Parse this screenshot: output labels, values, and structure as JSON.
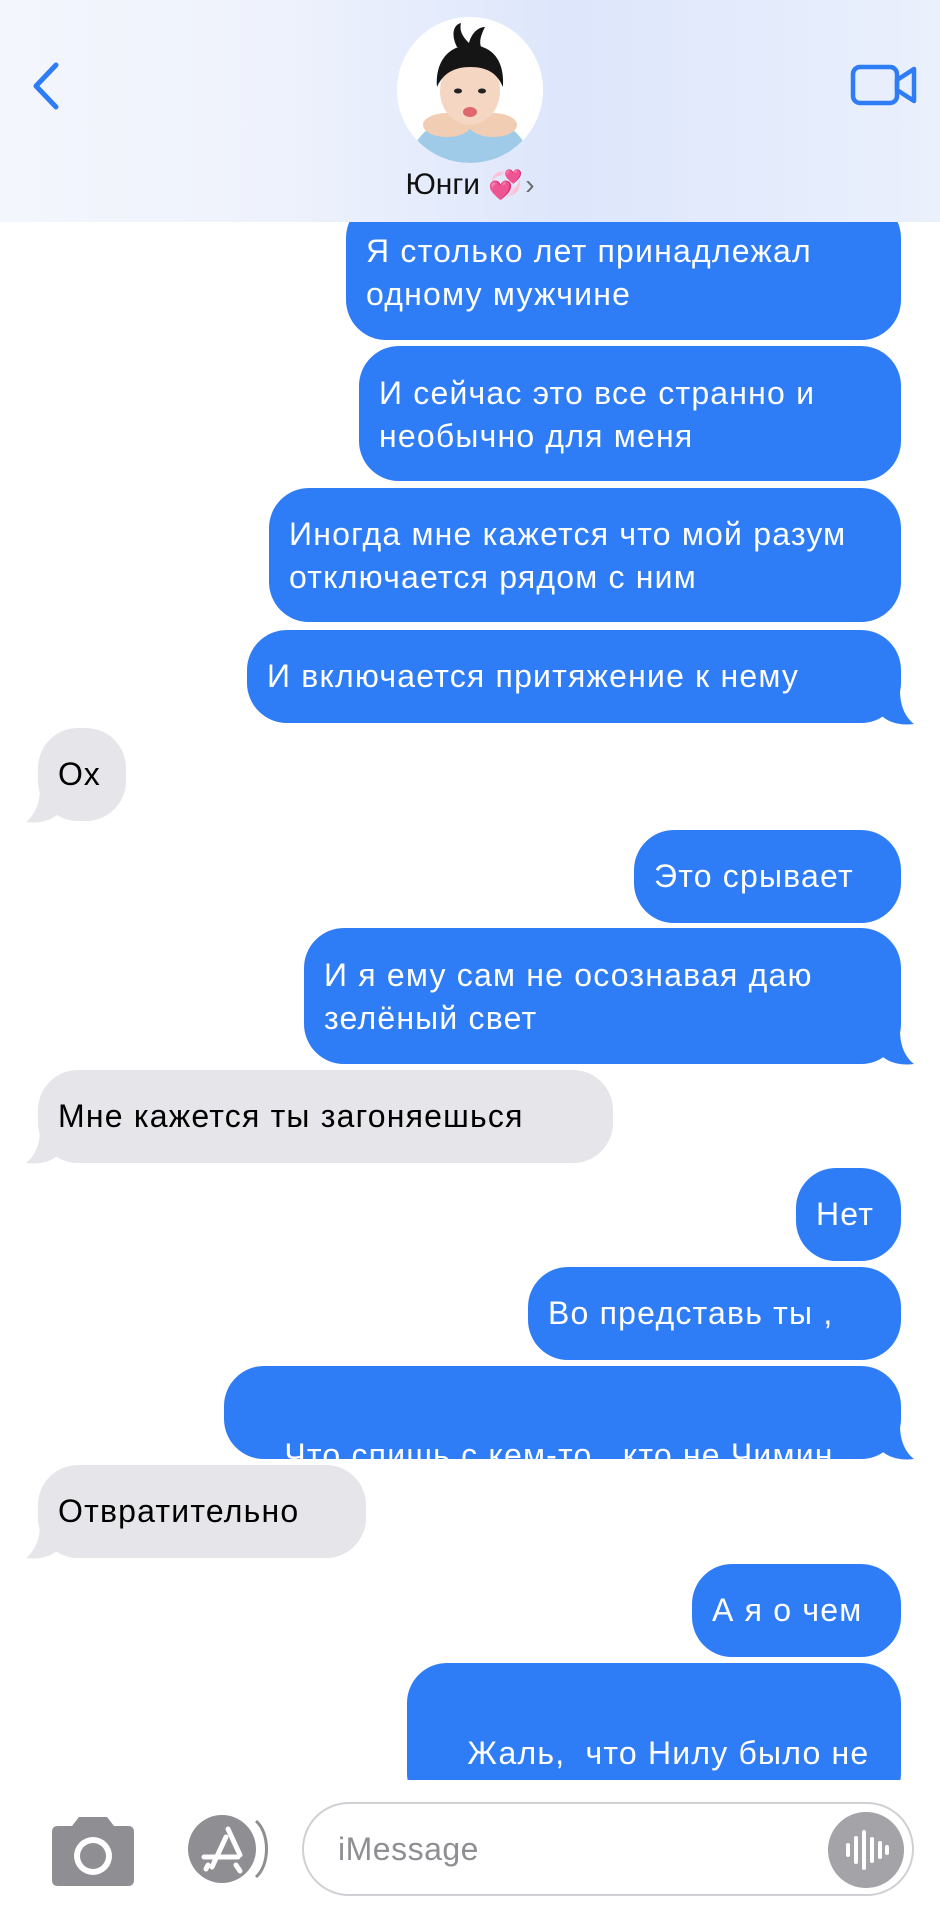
{
  "header": {
    "contact_name": "Юнги",
    "heart_emoji": "💞",
    "chevron": "›",
    "back_icon": "chevron-left-icon",
    "video_icon": "video-camera-icon",
    "accent": "#2e7cf6"
  },
  "messages": [
    {
      "side": "sent",
      "text": "Я столько лет принадлежал одному мужчине"
    },
    {
      "side": "sent",
      "text": "И сейчас это все странно и необычно для меня"
    },
    {
      "side": "sent",
      "text": "Иногда мне кажется что мой разум отключается рядом с ним"
    },
    {
      "side": "sent",
      "text": "И включается притяжение к нему"
    },
    {
      "side": "received",
      "text": "Ох"
    },
    {
      "side": "sent",
      "text": "Это срывает"
    },
    {
      "side": "sent",
      "text": "И я ему сам не осознавая даю зелёный свет"
    },
    {
      "side": "received",
      "text": "Мне кажется ты загоняешься"
    },
    {
      "side": "sent",
      "text": "Нет"
    },
    {
      "side": "sent",
      "text": "Во представь ты ,"
    },
    {
      "side": "sent",
      "text": "Что спишь с кем-то,  кто не Чимин"
    },
    {
      "side": "received",
      "text": "Отвратительно"
    },
    {
      "side": "sent",
      "text": "А я о чем"
    },
    {
      "side": "sent",
      "text": "Жаль,  что Нилу было не отвратительно"
    }
  ],
  "composer": {
    "placeholder": "iMessage",
    "camera_icon": "camera-icon",
    "apps_icon": "app-store-icon",
    "audio_icon": "audio-waveform-icon"
  },
  "colors": {
    "sent_bubble": "#2e7cf6",
    "received_bubble": "#e5e5ea"
  }
}
